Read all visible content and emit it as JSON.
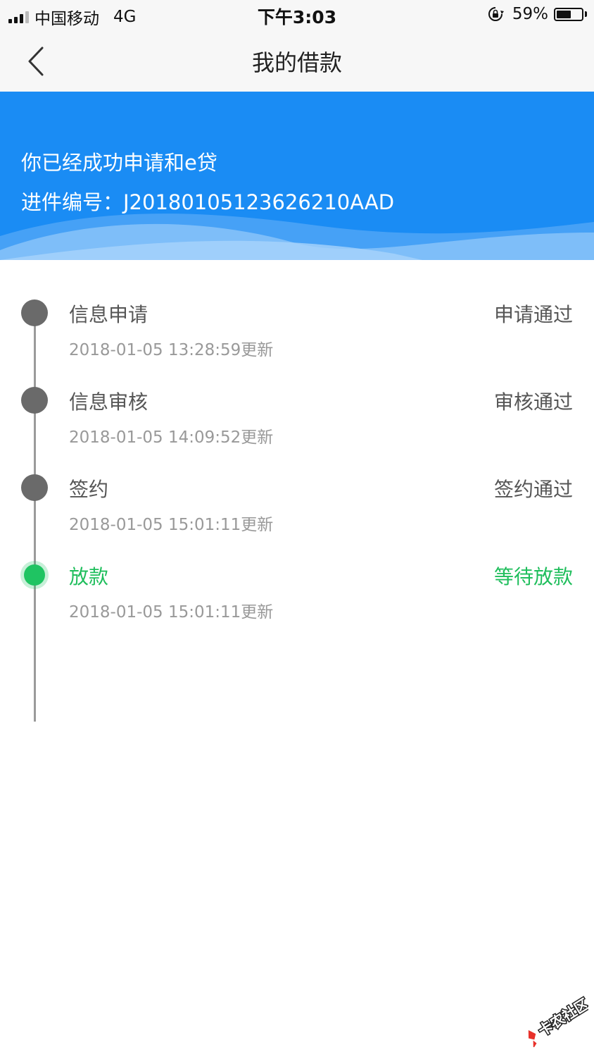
{
  "status_bar": {
    "carrier": "中国移动",
    "network": "4G",
    "time": "下午3:03",
    "battery_percent": "59%",
    "battery_level": 0.59,
    "icons": [
      "signal-icon",
      "rotation-lock-icon",
      "battery-icon"
    ]
  },
  "nav": {
    "back_icon": "chevron-left-icon",
    "title": "我的借款"
  },
  "banner": {
    "line1": "你已经成功申请和e贷",
    "line2": "进件编号：J20180105123626210AAD",
    "color": "#1a8cf4"
  },
  "timeline": {
    "items": [
      {
        "title": "信息申请",
        "time": "2018-01-05 13:28:59更新",
        "status": "申请通过"
      },
      {
        "title": "信息审核",
        "time": "2018-01-05 14:09:52更新",
        "status": "审核通过"
      },
      {
        "title": "签约",
        "time": "2018-01-05 15:01:11更新",
        "status": "签约通过"
      },
      {
        "title": "放款",
        "time": "2018-01-05 15:01:11更新",
        "status": "等待放款"
      }
    ],
    "active_color": "#1fbe5c",
    "done_color": "#6a6a6a"
  },
  "watermark": {
    "text": "卡农社区"
  }
}
